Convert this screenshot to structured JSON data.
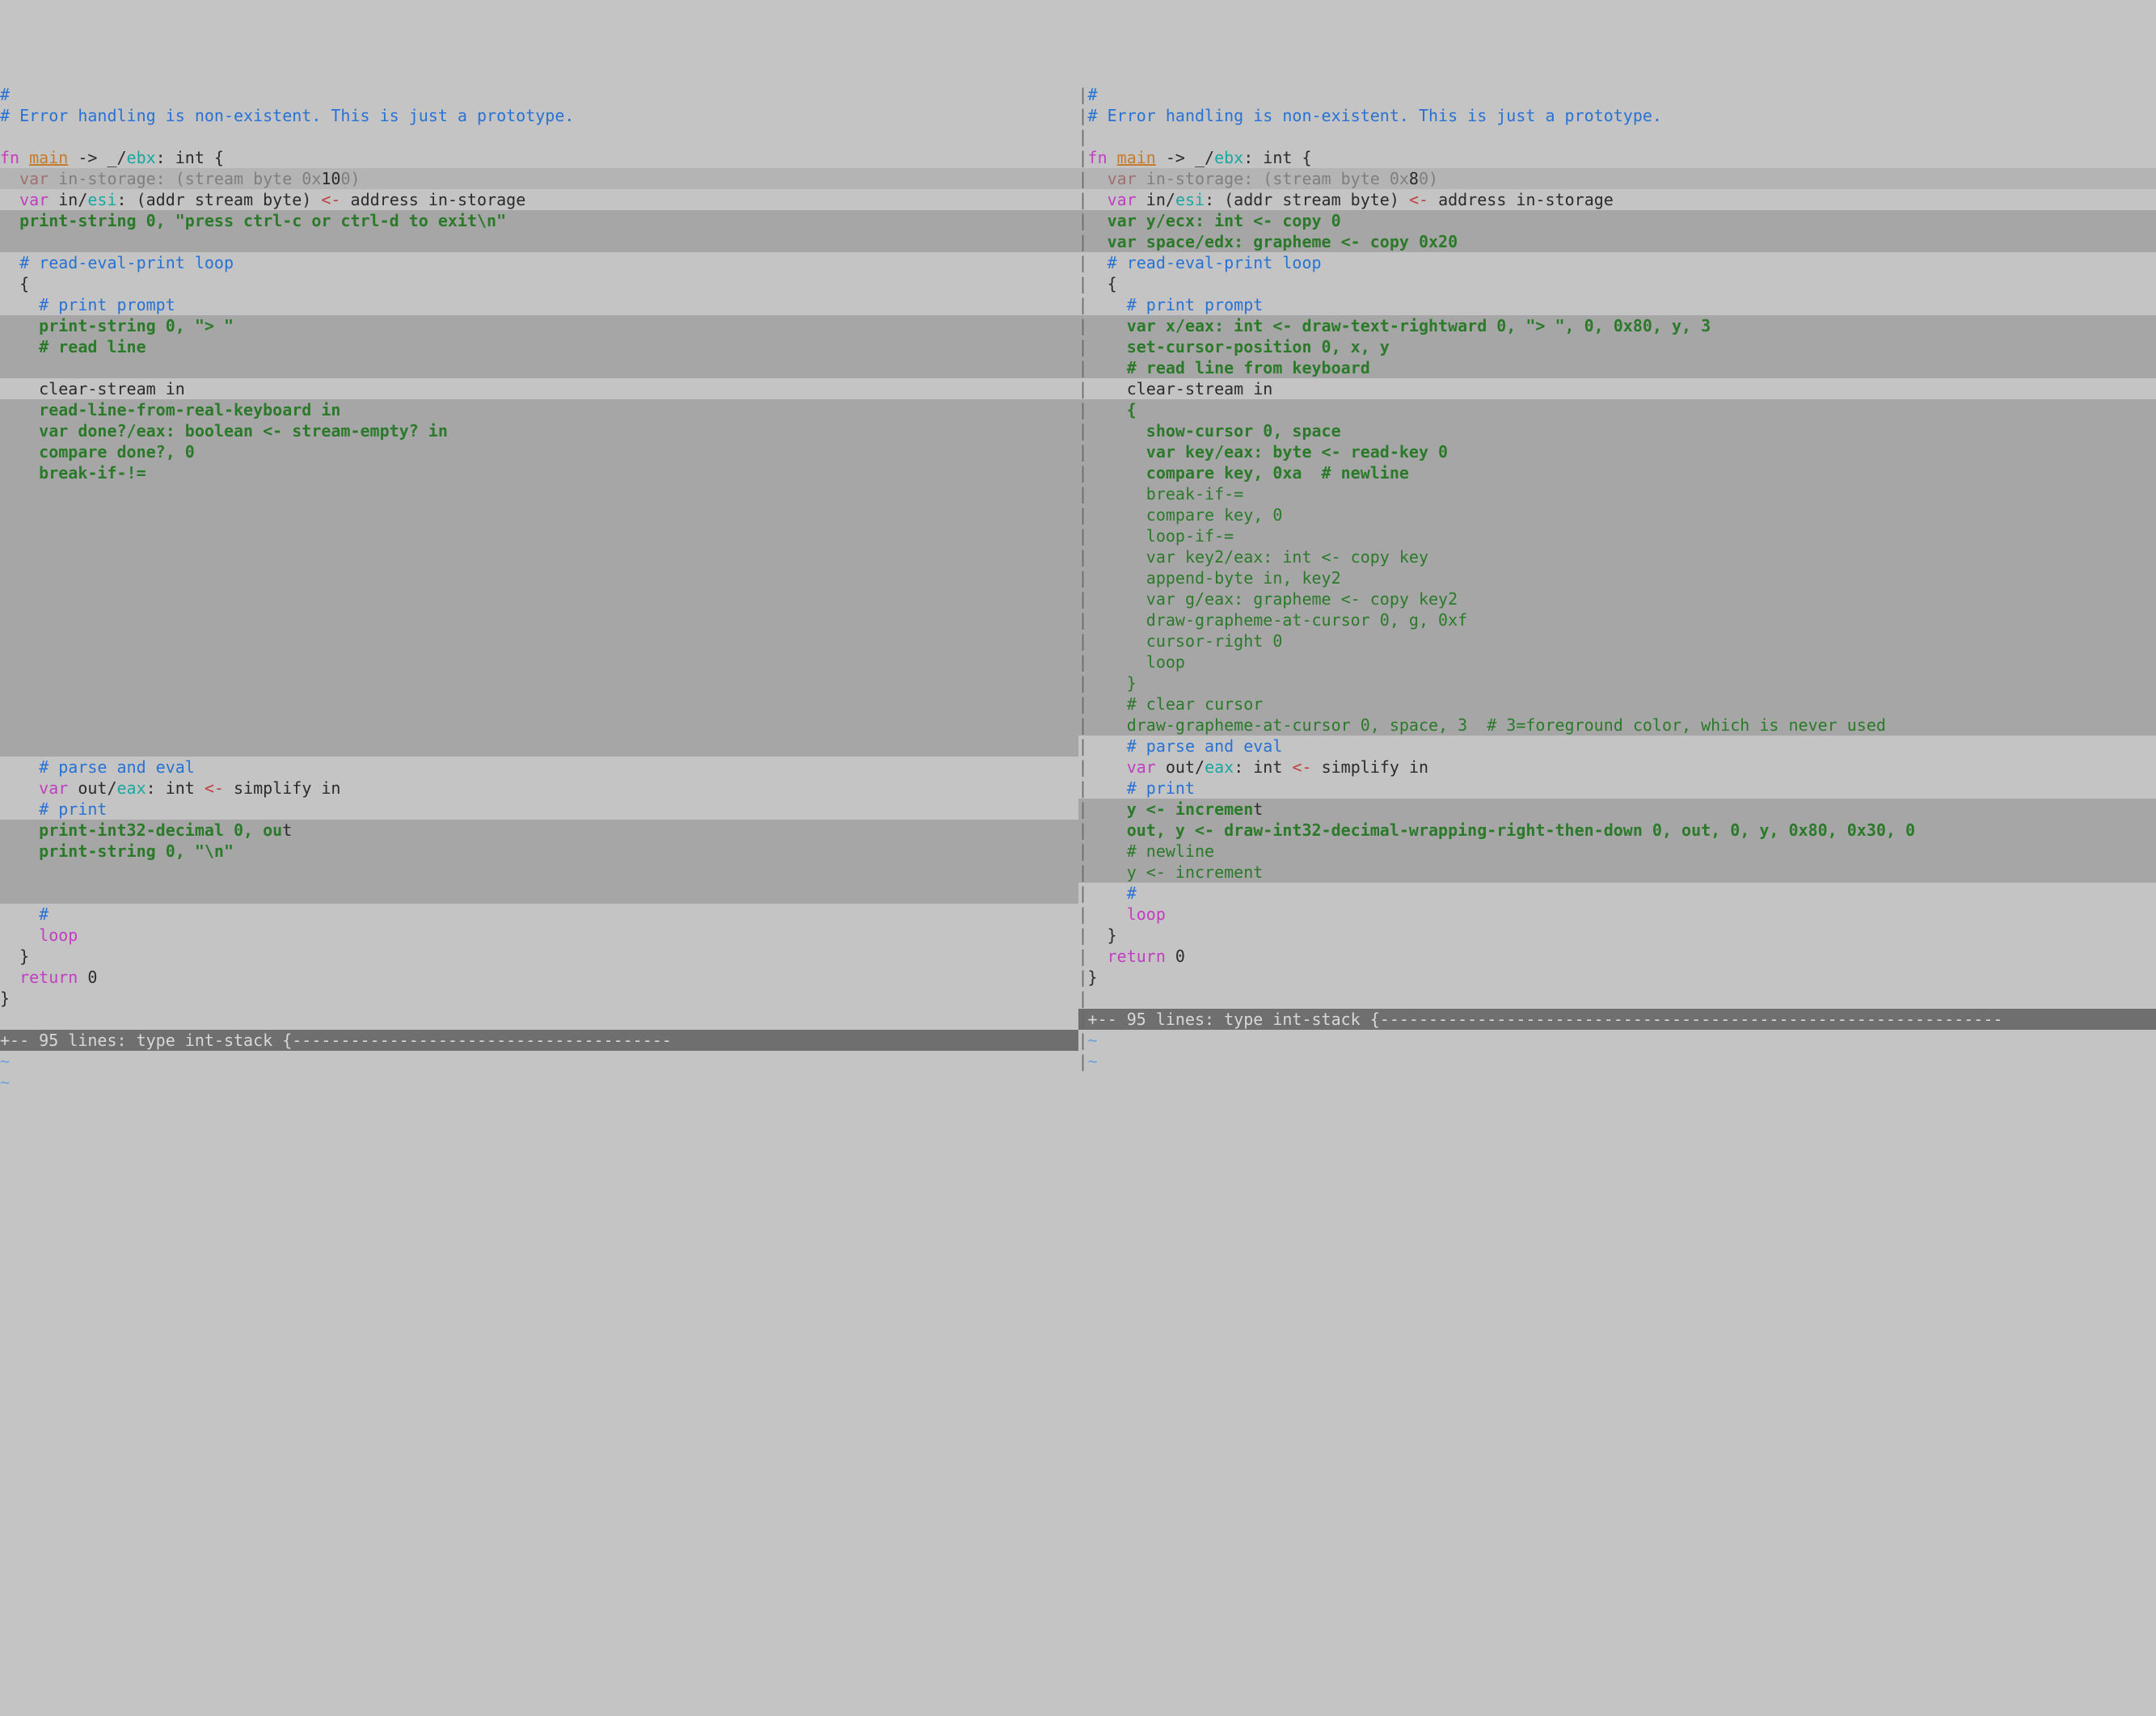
{
  "left": {
    "lines": [
      {
        "cls": "",
        "html": [
          {
            "c": "comment",
            "t": "#"
          }
        ]
      },
      {
        "cls": "",
        "html": [
          {
            "c": "comment",
            "t": "# Error handling is non-existent. This is just a prototype."
          }
        ]
      },
      {
        "cls": "",
        "html": [
          {
            "c": "",
            "t": ""
          }
        ]
      },
      {
        "cls": "",
        "html": [
          {
            "c": "kw",
            "t": "fn "
          },
          {
            "c": "fn-name",
            "t": "main"
          },
          {
            "c": "text",
            "t": " -> _/"
          },
          {
            "c": "reg",
            "t": "ebx"
          },
          {
            "c": "text",
            "t": ": int {"
          }
        ]
      },
      {
        "cls": "diff-del",
        "html": [
          {
            "c": "dimred",
            "t": "  var"
          },
          {
            "c": "dim",
            "t": " in-storage: (stream byte 0x"
          },
          {
            "c": "text",
            "t": "10"
          },
          {
            "c": "dim",
            "t": "0)"
          }
        ]
      },
      {
        "cls": "",
        "html": [
          {
            "c": "text",
            "t": "  "
          },
          {
            "c": "kw",
            "t": "var"
          },
          {
            "c": "text",
            "t": " in/"
          },
          {
            "c": "reg",
            "t": "esi"
          },
          {
            "c": "text",
            "t": ": (addr stream byte) "
          },
          {
            "c": "op",
            "t": "<-"
          },
          {
            "c": "text",
            "t": " address in-storage"
          }
        ]
      },
      {
        "cls": "diff-add",
        "html": [
          {
            "c": "added",
            "t": "  print-string 0, \"press ctrl-c or ctrl-d to exit\\n\""
          }
        ]
      },
      {
        "cls": "diff-add",
        "html": [
          {
            "c": "",
            "t": ""
          }
        ]
      },
      {
        "cls": "",
        "html": [
          {
            "c": "text",
            "t": "  "
          },
          {
            "c": "comment",
            "t": "# read-eval-print loop"
          }
        ]
      },
      {
        "cls": "",
        "html": [
          {
            "c": "text",
            "t": "  {"
          }
        ]
      },
      {
        "cls": "",
        "html": [
          {
            "c": "text",
            "t": "    "
          },
          {
            "c": "comment",
            "t": "# print prompt"
          }
        ]
      },
      {
        "cls": "diff-add",
        "html": [
          {
            "c": "added",
            "t": "    print-string 0, \"> \""
          }
        ]
      },
      {
        "cls": "diff-add",
        "html": [
          {
            "c": "added",
            "t": "    # read line"
          }
        ]
      },
      {
        "cls": "diff-add",
        "html": [
          {
            "c": "",
            "t": ""
          }
        ]
      },
      {
        "cls": "",
        "html": [
          {
            "c": "text",
            "t": "    clear-stream in"
          }
        ]
      },
      {
        "cls": "diff-add",
        "html": [
          {
            "c": "added",
            "t": "    read-line-from-real-keyboard in"
          }
        ]
      },
      {
        "cls": "diff-add",
        "html": [
          {
            "c": "added",
            "t": "    var done?/eax: boolean <- stream-empty? in"
          }
        ]
      },
      {
        "cls": "diff-add",
        "html": [
          {
            "c": "added",
            "t": "    compare done?, 0"
          }
        ]
      },
      {
        "cls": "diff-add",
        "html": [
          {
            "c": "added",
            "t": "    break-if-!="
          }
        ]
      },
      {
        "cls": "diff-add",
        "html": [
          {
            "c": "",
            "t": ""
          }
        ]
      },
      {
        "cls": "diff-add",
        "html": [
          {
            "c": "",
            "t": ""
          }
        ]
      },
      {
        "cls": "diff-add",
        "html": [
          {
            "c": "",
            "t": ""
          }
        ]
      },
      {
        "cls": "diff-add",
        "html": [
          {
            "c": "",
            "t": ""
          }
        ]
      },
      {
        "cls": "diff-add",
        "html": [
          {
            "c": "",
            "t": ""
          }
        ]
      },
      {
        "cls": "diff-add",
        "html": [
          {
            "c": "",
            "t": ""
          }
        ]
      },
      {
        "cls": "diff-add",
        "html": [
          {
            "c": "",
            "t": ""
          }
        ]
      },
      {
        "cls": "diff-add",
        "html": [
          {
            "c": "",
            "t": ""
          }
        ]
      },
      {
        "cls": "diff-add",
        "html": [
          {
            "c": "",
            "t": ""
          }
        ]
      },
      {
        "cls": "diff-add",
        "html": [
          {
            "c": "",
            "t": ""
          }
        ]
      },
      {
        "cls": "diff-add",
        "html": [
          {
            "c": "",
            "t": ""
          }
        ]
      },
      {
        "cls": "diff-add",
        "html": [
          {
            "c": "",
            "t": ""
          }
        ]
      },
      {
        "cls": "diff-add",
        "html": [
          {
            "c": "",
            "t": ""
          }
        ]
      },
      {
        "cls": "",
        "html": [
          {
            "c": "text",
            "t": "    "
          },
          {
            "c": "comment",
            "t": "# parse and eval"
          }
        ]
      },
      {
        "cls": "",
        "html": [
          {
            "c": "text",
            "t": "    "
          },
          {
            "c": "kw",
            "t": "var"
          },
          {
            "c": "text",
            "t": " out/"
          },
          {
            "c": "reg",
            "t": "eax"
          },
          {
            "c": "text",
            "t": ": int "
          },
          {
            "c": "op",
            "t": "<-"
          },
          {
            "c": "text",
            "t": " simplify in"
          }
        ]
      },
      {
        "cls": "",
        "html": [
          {
            "c": "text",
            "t": "    "
          },
          {
            "c": "comment",
            "t": "# print"
          }
        ]
      },
      {
        "cls": "diff-add",
        "html": [
          {
            "c": "added",
            "t": "    print-int32-decimal 0, ou"
          },
          {
            "c": "text",
            "t": "t"
          }
        ]
      },
      {
        "cls": "diff-add",
        "html": [
          {
            "c": "added",
            "t": "    print-string 0, \"\\n\""
          }
        ]
      },
      {
        "cls": "diff-add",
        "html": [
          {
            "c": "",
            "t": ""
          }
        ]
      },
      {
        "cls": "diff-add",
        "html": [
          {
            "c": "",
            "t": ""
          }
        ]
      },
      {
        "cls": "",
        "html": [
          {
            "c": "text",
            "t": "    "
          },
          {
            "c": "comment",
            "t": "#"
          }
        ]
      },
      {
        "cls": "",
        "html": [
          {
            "c": "text",
            "t": "    "
          },
          {
            "c": "kw",
            "t": "loop"
          }
        ]
      },
      {
        "cls": "",
        "html": [
          {
            "c": "text",
            "t": "  }"
          }
        ]
      },
      {
        "cls": "",
        "html": [
          {
            "c": "text",
            "t": "  "
          },
          {
            "c": "kw",
            "t": "return"
          },
          {
            "c": "text",
            "t": " 0"
          }
        ]
      },
      {
        "cls": "",
        "html": [
          {
            "c": "text",
            "t": "}"
          }
        ]
      },
      {
        "cls": "",
        "html": [
          {
            "c": "",
            "t": ""
          }
        ]
      },
      {
        "cls": "fold",
        "html": [
          {
            "c": "",
            "t": "+-- 95 lines: type int-stack {---------------------------------------"
          }
        ]
      },
      {
        "cls": "",
        "html": [
          {
            "c": "tilde",
            "t": "~"
          }
        ]
      },
      {
        "cls": "",
        "html": [
          {
            "c": "tilde",
            "t": "~"
          }
        ]
      }
    ]
  },
  "right": {
    "lines": [
      {
        "cls": "",
        "html": [
          {
            "c": "comment",
            "t": "#"
          }
        ]
      },
      {
        "cls": "",
        "html": [
          {
            "c": "comment",
            "t": "# Error handling is non-existent. This is just a prototype."
          }
        ]
      },
      {
        "cls": "",
        "html": [
          {
            "c": "",
            "t": ""
          }
        ]
      },
      {
        "cls": "",
        "html": [
          {
            "c": "kw",
            "t": "fn "
          },
          {
            "c": "fn-name",
            "t": "main"
          },
          {
            "c": "text",
            "t": " -> _/"
          },
          {
            "c": "reg",
            "t": "ebx"
          },
          {
            "c": "text",
            "t": ": int {"
          }
        ]
      },
      {
        "cls": "diff-del",
        "html": [
          {
            "c": "dimred",
            "t": "  var"
          },
          {
            "c": "dim",
            "t": " in-storage: (stream byte 0x"
          },
          {
            "c": "text",
            "t": "8"
          },
          {
            "c": "dim",
            "t": "0)"
          }
        ]
      },
      {
        "cls": "",
        "html": [
          {
            "c": "text",
            "t": "  "
          },
          {
            "c": "kw",
            "t": "var"
          },
          {
            "c": "text",
            "t": " in/"
          },
          {
            "c": "reg",
            "t": "esi"
          },
          {
            "c": "text",
            "t": ": (addr stream byte) "
          },
          {
            "c": "op",
            "t": "<-"
          },
          {
            "c": "text",
            "t": " address in-storage"
          }
        ]
      },
      {
        "cls": "diff-add",
        "html": [
          {
            "c": "added",
            "t": "  var y/ecx: int <- copy 0"
          }
        ]
      },
      {
        "cls": "diff-add",
        "html": [
          {
            "c": "added",
            "t": "  var space/edx: grapheme <- copy 0x20"
          }
        ]
      },
      {
        "cls": "",
        "html": [
          {
            "c": "text",
            "t": "  "
          },
          {
            "c": "comment",
            "t": "# read-eval-print loop"
          }
        ]
      },
      {
        "cls": "",
        "html": [
          {
            "c": "text",
            "t": "  {"
          }
        ]
      },
      {
        "cls": "",
        "html": [
          {
            "c": "text",
            "t": "    "
          },
          {
            "c": "comment",
            "t": "# print prompt"
          }
        ]
      },
      {
        "cls": "diff-add",
        "html": [
          {
            "c": "added",
            "t": "    var x/eax: int <- draw-text-rightward 0, \"> \", 0, 0x80, y, 3"
          }
        ]
      },
      {
        "cls": "diff-add",
        "html": [
          {
            "c": "added",
            "t": "    set-cursor-position 0, x, y"
          }
        ]
      },
      {
        "cls": "diff-add",
        "html": [
          {
            "c": "added",
            "t": "    # read line from keyboard"
          }
        ]
      },
      {
        "cls": "",
        "html": [
          {
            "c": "text",
            "t": "    clear-stream in"
          }
        ]
      },
      {
        "cls": "diff-add",
        "html": [
          {
            "c": "added",
            "t": "    {"
          }
        ]
      },
      {
        "cls": "diff-add",
        "html": [
          {
            "c": "added",
            "t": "      show-cursor 0, space"
          }
        ]
      },
      {
        "cls": "diff-add",
        "html": [
          {
            "c": "added",
            "t": "      var key/eax: byte <- read-key 0"
          }
        ]
      },
      {
        "cls": "diff-add",
        "html": [
          {
            "c": "added",
            "t": "      compare key, 0xa  # newline"
          }
        ]
      },
      {
        "cls": "diff-add",
        "html": [
          {
            "c": "added-plain",
            "t": "      break-if-="
          }
        ]
      },
      {
        "cls": "diff-add",
        "html": [
          {
            "c": "added-plain",
            "t": "      compare key, 0"
          }
        ]
      },
      {
        "cls": "diff-add",
        "html": [
          {
            "c": "added-plain",
            "t": "      loop-if-="
          }
        ]
      },
      {
        "cls": "diff-add",
        "html": [
          {
            "c": "added-plain",
            "t": "      var key2/eax: int <- copy key"
          }
        ]
      },
      {
        "cls": "diff-add",
        "html": [
          {
            "c": "added-plain",
            "t": "      append-byte in, key2"
          }
        ]
      },
      {
        "cls": "diff-add",
        "html": [
          {
            "c": "added-plain",
            "t": "      var g/eax: grapheme <- copy key2"
          }
        ]
      },
      {
        "cls": "diff-add",
        "html": [
          {
            "c": "added-plain",
            "t": "      draw-grapheme-at-cursor 0, g, 0xf"
          }
        ]
      },
      {
        "cls": "diff-add",
        "html": [
          {
            "c": "added-plain",
            "t": "      cursor-right 0"
          }
        ]
      },
      {
        "cls": "diff-add",
        "html": [
          {
            "c": "added-plain",
            "t": "      loop"
          }
        ]
      },
      {
        "cls": "diff-add",
        "html": [
          {
            "c": "added-plain",
            "t": "    }"
          }
        ]
      },
      {
        "cls": "diff-add",
        "html": [
          {
            "c": "added-plain",
            "t": "    # clear cursor"
          }
        ]
      },
      {
        "cls": "diff-add",
        "html": [
          {
            "c": "added-plain",
            "t": "    draw-grapheme-at-cursor 0, space, 3  # 3=foreground color, which is never used"
          }
        ]
      },
      {
        "cls": "",
        "html": [
          {
            "c": "text",
            "t": "    "
          },
          {
            "c": "comment",
            "t": "# parse and eval"
          }
        ]
      },
      {
        "cls": "",
        "html": [
          {
            "c": "text",
            "t": "    "
          },
          {
            "c": "kw",
            "t": "var"
          },
          {
            "c": "text",
            "t": " out/"
          },
          {
            "c": "reg",
            "t": "eax"
          },
          {
            "c": "text",
            "t": ": int "
          },
          {
            "c": "op",
            "t": "<-"
          },
          {
            "c": "text",
            "t": " simplify in"
          }
        ]
      },
      {
        "cls": "",
        "html": [
          {
            "c": "text",
            "t": "    "
          },
          {
            "c": "comment",
            "t": "# print"
          }
        ]
      },
      {
        "cls": "diff-add",
        "html": [
          {
            "c": "added",
            "t": "    y <- incremen"
          },
          {
            "c": "text",
            "t": "t"
          }
        ]
      },
      {
        "cls": "diff-add",
        "html": [
          {
            "c": "added",
            "t": "    out, y <- draw-int32-decimal-wrapping-right-then-down 0, out, 0, y, 0x80, 0x30, 0"
          }
        ]
      },
      {
        "cls": "diff-add",
        "html": [
          {
            "c": "added-plain",
            "t": "    # newline"
          }
        ]
      },
      {
        "cls": "diff-add",
        "html": [
          {
            "c": "added-plain",
            "t": "    y <- increment"
          }
        ]
      },
      {
        "cls": "",
        "html": [
          {
            "c": "text",
            "t": "    "
          },
          {
            "c": "comment",
            "t": "#"
          }
        ]
      },
      {
        "cls": "",
        "html": [
          {
            "c": "text",
            "t": "    "
          },
          {
            "c": "kw",
            "t": "loop"
          }
        ]
      },
      {
        "cls": "",
        "html": [
          {
            "c": "text",
            "t": "  }"
          }
        ]
      },
      {
        "cls": "",
        "html": [
          {
            "c": "text",
            "t": "  "
          },
          {
            "c": "kw",
            "t": "return"
          },
          {
            "c": "text",
            "t": " 0"
          }
        ]
      },
      {
        "cls": "",
        "html": [
          {
            "c": "text",
            "t": "}"
          }
        ]
      },
      {
        "cls": "",
        "html": [
          {
            "c": "",
            "t": ""
          }
        ]
      },
      {
        "cls": "fold",
        "html": [
          {
            "c": "",
            "t": "+-- 95 lines: type int-stack {----------------------------------------------------------------"
          }
        ]
      },
      {
        "cls": "",
        "html": [
          {
            "c": "tilde",
            "t": "~"
          }
        ]
      },
      {
        "cls": "",
        "html": [
          {
            "c": "tilde",
            "t": "~"
          }
        ]
      }
    ]
  },
  "separator": "|"
}
